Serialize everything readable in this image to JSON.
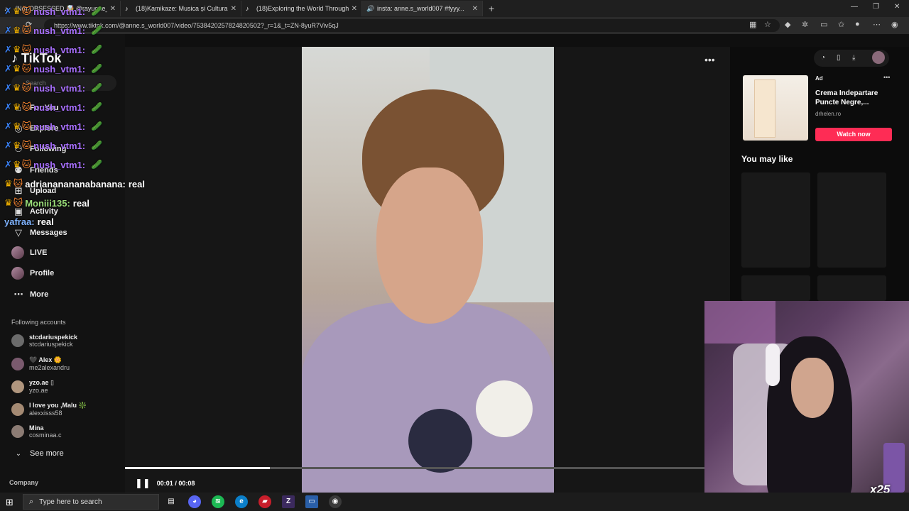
{
  "browser": {
    "tabs": [
      {
        "label": "(No) OBSESSED 🤯 @rayuone_respo..."
      },
      {
        "label": "(18)Kamikaze: Musica și Cultura d..."
      },
      {
        "label": "(18)Exploring the World Through..."
      },
      {
        "label": "insta: anne.s_world007 #fyyy..."
      }
    ],
    "new_tab": "+",
    "url": "https://www.tiktok.com/@anne.s_world007/video/7538420257824820502?_r=1&_t=ZN-8yuR7Viv5qJ",
    "window_controls": {
      "minimize": "—",
      "maximize": "❐",
      "close": "✕"
    }
  },
  "sidebar": {
    "logo": "TikTok",
    "search_placeholder": "Search",
    "nav": [
      {
        "label": "For You",
        "icon": "home-icon"
      },
      {
        "label": "Explore",
        "icon": "compass-icon"
      },
      {
        "label": "Following",
        "icon": "following-icon"
      },
      {
        "label": "Friends",
        "icon": "friends-icon"
      },
      {
        "label": "Upload",
        "icon": "plus-square-icon"
      },
      {
        "label": "Activity",
        "icon": "activity-icon"
      },
      {
        "label": "Messages",
        "icon": "send-icon"
      },
      {
        "label": "LIVE",
        "icon": "live-icon"
      },
      {
        "label": "Profile",
        "icon": "profile-icon"
      },
      {
        "label": "More",
        "icon": "more-icon"
      }
    ],
    "following_heading": "Following accounts",
    "accounts": [
      {
        "name": "stcdariuspekick",
        "handle": "stcdariuspekick",
        "color": "#6b6b6b"
      },
      {
        "name": "🖤 Alex 🌼",
        "handle": "me2alexandru",
        "color": "#7a5a6e"
      },
      {
        "name": "yzo.ae ▯",
        "handle": "yzo.ae",
        "color": "#b0967e"
      },
      {
        "name": "I love you ,Malu ❇️",
        "handle": "alexxisss58",
        "color": "#a48a73"
      },
      {
        "name": "Mina",
        "handle": "cosminaa.c",
        "color": "#8c7c74"
      }
    ],
    "see_more": "See more",
    "company": "Company"
  },
  "chat": [
    {
      "user": "nush_vtm1:",
      "msg": "",
      "emote": "🥒"
    },
    {
      "user": "nush_vtm1:",
      "msg": "",
      "emote": "🥒"
    },
    {
      "user": "nush_vtm1:",
      "msg": "",
      "emote": "🥒"
    },
    {
      "user": "nush_vtm1:",
      "msg": "",
      "emote": "🥒"
    },
    {
      "user": "nush_vtm1:",
      "msg": "",
      "emote": "🥒"
    },
    {
      "user": "nush_vtm1:",
      "msg": "",
      "emote": "🥒"
    },
    {
      "user": "nush_vtm1:",
      "msg": "",
      "emote": "🥒"
    },
    {
      "user": "nush_vtm1:",
      "msg": "",
      "emote": "🥒"
    },
    {
      "user": "nush_vtm1:",
      "msg": "",
      "emote": "🥒"
    },
    {
      "user": "adriananananabanana:",
      "msg": "real",
      "emote": "",
      "color": "#ffffff"
    },
    {
      "user": "Moniii135:",
      "msg": "real",
      "emote": "",
      "color": "#9be07a"
    },
    {
      "user": "yafraa:",
      "msg": "real",
      "emote": "",
      "color": "#7fb3ff"
    }
  ],
  "video": {
    "time": "00:01 / 00:08",
    "progress": 0.25,
    "pause_icon": "❚❚",
    "more": "•••"
  },
  "ad": {
    "tag": "Ad",
    "title": "Crema Indepartare Puncte Negre,...",
    "domain": "drhelen.ro",
    "button": "Watch now",
    "dots": "•••"
  },
  "you_may_like": "You may like",
  "overlay": {
    "multiplier": "x25"
  },
  "taskbar": {
    "search_placeholder": "Type here to search",
    "start_icon": "windows-icon"
  },
  "colors": {
    "accent": "#fe2c55",
    "chat_user": "#a970ff",
    "background": "#0f0f0f"
  }
}
